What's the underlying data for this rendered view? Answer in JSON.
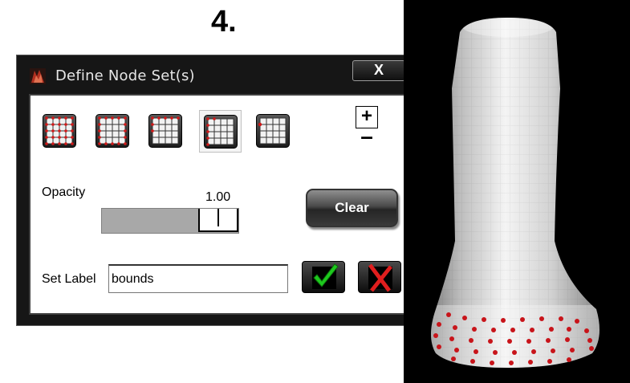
{
  "step_number": "4.",
  "window": {
    "title": "Define Node Set(s)",
    "close_label": "X"
  },
  "selection_modes": [
    {
      "name": "all-nodes",
      "selected": false
    },
    {
      "name": "boundary-nodes",
      "selected": false
    },
    {
      "name": "top-edge-nodes",
      "selected": false
    },
    {
      "name": "left-edge-nodes",
      "selected": true
    },
    {
      "name": "single-corner-node",
      "selected": false
    }
  ],
  "zoom": {
    "plus_label": "+",
    "minus_label": "–"
  },
  "opacity": {
    "label": "Opacity",
    "value": "1.00"
  },
  "clear_label": "Clear",
  "set_label": {
    "label": "Set Label",
    "value": "bounds"
  },
  "icons": {
    "app": "node-set-app-icon",
    "ok": "green-check-icon",
    "cancel": "red-x-icon"
  },
  "colors": {
    "node_marker": "#d01818",
    "window_frame": "#161616",
    "confirm_green": "#1ec81e",
    "cancel_red": "#e01e1e"
  }
}
